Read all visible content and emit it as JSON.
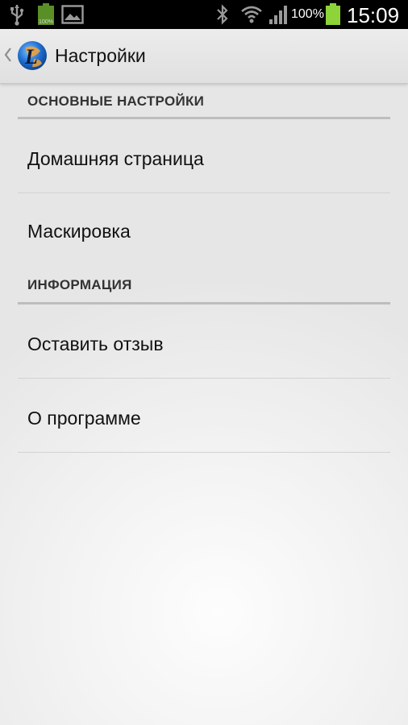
{
  "status_bar": {
    "icons": [
      "usb-icon",
      "battery-full-small-icon",
      "gallery-icon",
      "bluetooth-icon",
      "wifi-icon",
      "signal-icon",
      "battery-icon"
    ],
    "small_battery_text": "100%",
    "battery_percent": "100%",
    "time": "15:09"
  },
  "action_bar": {
    "title": "Настройки",
    "logo_letter": "L"
  },
  "categories": [
    {
      "title": "ОСНОВНЫЕ НАСТРОЙКИ",
      "items": [
        "Домашняя страница",
        "Маскировка"
      ]
    },
    {
      "title": "ИНФОРМАЦИЯ",
      "items": [
        "Оставить отзыв",
        "О программе"
      ]
    }
  ],
  "colors": {
    "status_bar": "#000000",
    "battery_green": "#8ed33a",
    "divider": "#bdbdbd"
  }
}
